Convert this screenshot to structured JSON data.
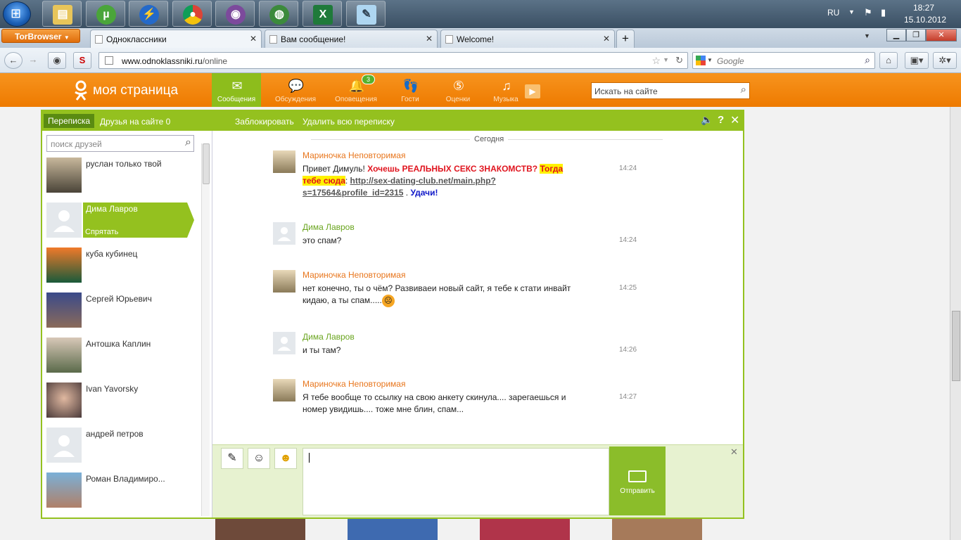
{
  "taskbar": {
    "apps": [
      "explorer-icon",
      "utorrent-icon",
      "flash-icon",
      "chrome-icon",
      "tor-icon",
      "globe-icon",
      "excel-icon",
      "notes-icon"
    ],
    "lang": "RU",
    "time": "18:27",
    "date": "15.10.2012"
  },
  "browser": {
    "tor_button": "TorBrowser",
    "tabs": [
      "Одноклассники",
      "Вам сообщение!",
      "Welcome!"
    ],
    "new_tab": "+",
    "url_domain": "www.odnoklassniki.ru",
    "url_path": "/online",
    "search_placeholder": "Google"
  },
  "ok": {
    "logo": "моя страница",
    "nav": [
      {
        "label": "Сообщения",
        "icon": "envelope-icon"
      },
      {
        "label": "Обсуждения",
        "icon": "speech-bubbles-icon"
      },
      {
        "label": "Оповещения",
        "icon": "bell-icon"
      },
      {
        "label": "Гости",
        "icon": "footprints-icon"
      },
      {
        "label": "Оценки",
        "icon": "rating-5-icon"
      },
      {
        "label": "Музыка",
        "icon": "music-note-icon"
      }
    ],
    "notif_badge": "3",
    "search_placeholder": "Искать на сайте"
  },
  "messenger": {
    "tab_active": "Переписка",
    "tab_friends": "Друзья на сайте 0",
    "block": "Заблокировать",
    "delete_all": "Удалить всю переписку",
    "friend_search_placeholder": "поиск друзей",
    "contacts": [
      {
        "name": "руслан только твой"
      },
      {
        "name": "Дима Лавров",
        "hide": "Спрятать"
      },
      {
        "name": "куба кубинец"
      },
      {
        "name": "Сергей Юрьевич"
      },
      {
        "name": "Антошка Каплин"
      },
      {
        "name": "Ivan Yavorsky"
      },
      {
        "name": "андрей петров"
      },
      {
        "name": "Роман Владимиро..."
      }
    ],
    "day": "Сегодня",
    "messages": [
      {
        "author": "Мариночка Неповторимая",
        "time": "14:24",
        "parts": {
          "a": "Привет Димуль! ",
          "b": "Хочешь РЕАЛЬНЫХ СЕКС ЗНАКОМСТВ?",
          "c": " ",
          "d": "Тогда тебе сюда",
          "e": ": ",
          "f": "http://sex-dating-club.net/main.php?s=17564&profile_id=2315",
          "g": " . ",
          "h": "Удачи!"
        }
      },
      {
        "author": "Дима Лавров",
        "time": "14:24",
        "text": "это спам?"
      },
      {
        "author": "Мариночка Неповторимая",
        "time": "14:25",
        "text": "нет конечно, ты о чём? Развиваеи новый сайт, я тебе к стати инвайт кидаю, а ты спам....."
      },
      {
        "author": "Дима Лавров",
        "time": "14:26",
        "text": "и ты там?"
      },
      {
        "author": "Мариночка Неповторимая",
        "time": "14:27",
        "text": "Я тебе вообще то ссылку на свою анкету скинула.... зарегаешься и номер увидишь.... тоже мне блин, спам..."
      }
    ],
    "send": "Отправить"
  }
}
